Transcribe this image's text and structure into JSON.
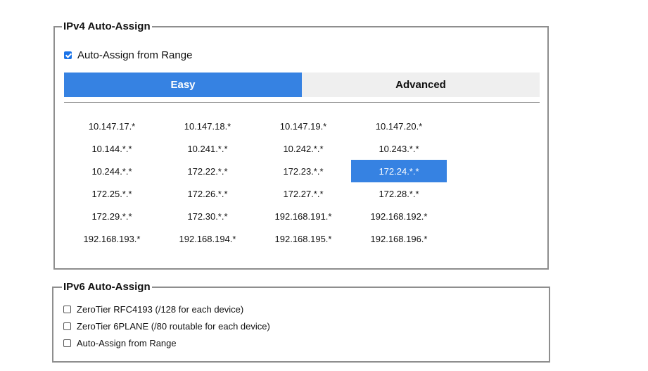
{
  "ipv4": {
    "legend": "IPv4 Auto-Assign",
    "auto_assign_label": "Auto-Assign from Range",
    "auto_assign_checked": true,
    "tabs": [
      {
        "label": "Easy",
        "active": true
      },
      {
        "label": "Advanced",
        "active": false
      }
    ],
    "selected_range": "172.24.*.*",
    "ranges": [
      "10.147.17.*",
      "10.147.18.*",
      "10.147.19.*",
      "10.147.20.*",
      "10.144.*.*",
      "10.241.*.*",
      "10.242.*.*",
      "10.243.*.*",
      "10.244.*.*",
      "172.22.*.*",
      "172.23.*.*",
      "172.24.*.*",
      "172.25.*.*",
      "172.26.*.*",
      "172.27.*.*",
      "172.28.*.*",
      "172.29.*.*",
      "172.30.*.*",
      "192.168.191.*",
      "192.168.192.*",
      "192.168.193.*",
      "192.168.194.*",
      "192.168.195.*",
      "192.168.196.*"
    ]
  },
  "ipv6": {
    "legend": "IPv6 Auto-Assign",
    "options": [
      {
        "label": "ZeroTier RFC4193 (/128 for each device)",
        "checked": false
      },
      {
        "label": "ZeroTier 6PLANE (/80 routable for each device)",
        "checked": false
      },
      {
        "label": "Auto-Assign from Range",
        "checked": false
      }
    ]
  },
  "colors": {
    "accent": "#3682e2",
    "inactive_tab": "#efefef",
    "border": "#8e8e8e"
  }
}
